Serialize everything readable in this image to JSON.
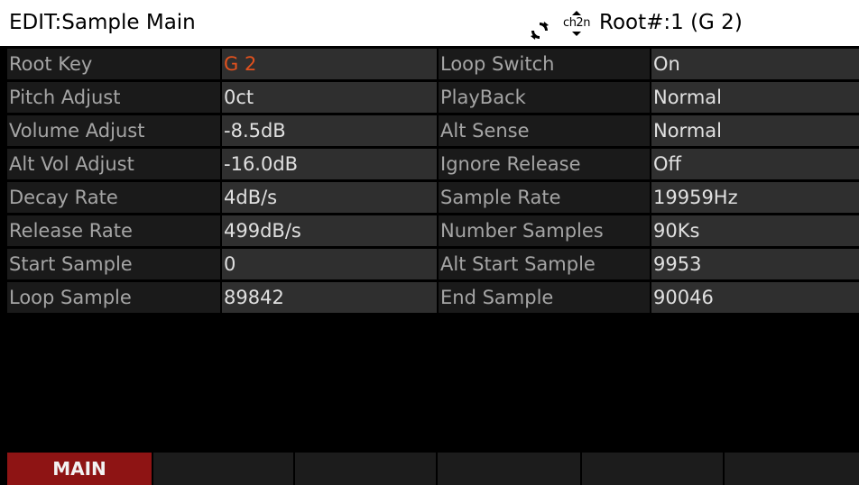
{
  "header": {
    "title": "EDIT:Sample Main",
    "sync_icon": "sync-icon",
    "channel_icon": "channel-updown-icon",
    "channel_icon_text": "ch2n",
    "root_label": "Root#:1 (G 2)"
  },
  "params": {
    "left": [
      {
        "label": "Root Key",
        "value": "G 2"
      },
      {
        "label": "Pitch Adjust",
        "value": "0ct"
      },
      {
        "label": "Volume Adjust",
        "value": "-8.5dB"
      },
      {
        "label": "Alt Vol Adjust",
        "value": "-16.0dB"
      },
      {
        "label": "Decay Rate",
        "value": "4dB/s"
      },
      {
        "label": "Release Rate",
        "value": "499dB/s"
      },
      {
        "label": "Start Sample",
        "value": "0"
      },
      {
        "label": "Loop Sample",
        "value": "89842"
      }
    ],
    "right": [
      {
        "label": "Loop Switch",
        "value": "On"
      },
      {
        "label": "PlayBack",
        "value": "Normal"
      },
      {
        "label": "Alt Sense",
        "value": "Normal"
      },
      {
        "label": "Ignore Release",
        "value": "Off"
      },
      {
        "label": "Sample Rate",
        "value": "19959Hz"
      },
      {
        "label": "Number Samples",
        "value": "90Ks"
      },
      {
        "label": "Alt Start Sample",
        "value": "9953"
      },
      {
        "label": "End Sample",
        "value": "90046"
      }
    ]
  },
  "softkeys": [
    {
      "label": "MAIN",
      "active": true
    },
    {
      "label": "",
      "active": false
    },
    {
      "label": "",
      "active": false
    },
    {
      "label": "",
      "active": false
    },
    {
      "label": "",
      "active": false
    },
    {
      "label": "",
      "active": false
    }
  ],
  "colors": {
    "background": "#000000",
    "title_bar": "#ffffff",
    "selected_value": "#e0511e",
    "active_softkey": "#8e1414"
  }
}
